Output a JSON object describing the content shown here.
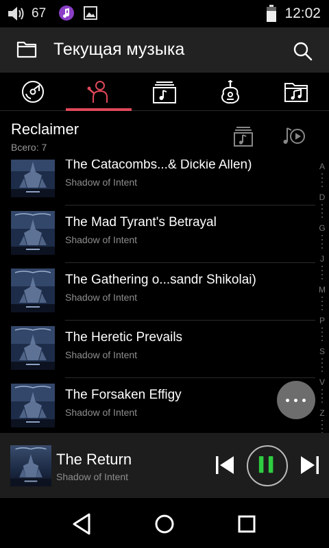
{
  "status_bar": {
    "level": "67",
    "time": "12:02",
    "icons": [
      "volume-icon",
      "music-app-icon",
      "image-icon",
      "battery-icon"
    ]
  },
  "app_bar": {
    "title": "Текущая музыка",
    "icons": [
      "folder-icon",
      "search-icon"
    ]
  },
  "tabs": [
    {
      "name": "tab-albums",
      "icon": "disc-icon",
      "active": false
    },
    {
      "name": "tab-artists",
      "icon": "singer-icon",
      "active": true
    },
    {
      "name": "tab-playlists",
      "icon": "playlist-icon",
      "active": false
    },
    {
      "name": "tab-genres",
      "icon": "guitar-icon",
      "active": false
    },
    {
      "name": "tab-folders",
      "icon": "music-folder-icon",
      "active": false
    }
  ],
  "colors": {
    "accent": "#e0485a",
    "app_bar_bg": "#222222",
    "mini_player_bg": "#1d1d1d",
    "pause_green": "#2ecc40"
  },
  "header": {
    "album": "Reclaimer",
    "count": "Всего: 7"
  },
  "tracks": [
    {
      "title": "The Catacombs...& Dickie Allen)",
      "artist": "Shadow of Intent"
    },
    {
      "title": "The Mad Tyrant's Betrayal",
      "artist": "Shadow of Intent"
    },
    {
      "title": "The Gathering o...sandr Shikolai)",
      "artist": "Shadow of Intent"
    },
    {
      "title": "The Heretic Prevails",
      "artist": "Shadow of Intent"
    },
    {
      "title": "The Forsaken Effigy",
      "artist": "Shadow of Intent"
    }
  ],
  "alphabet": [
    "A",
    "D",
    "G",
    "J",
    "M",
    "P",
    "S",
    "V",
    "Z",
    "#"
  ],
  "now_playing": {
    "title": "The Return",
    "artist": "Shadow of Intent"
  }
}
